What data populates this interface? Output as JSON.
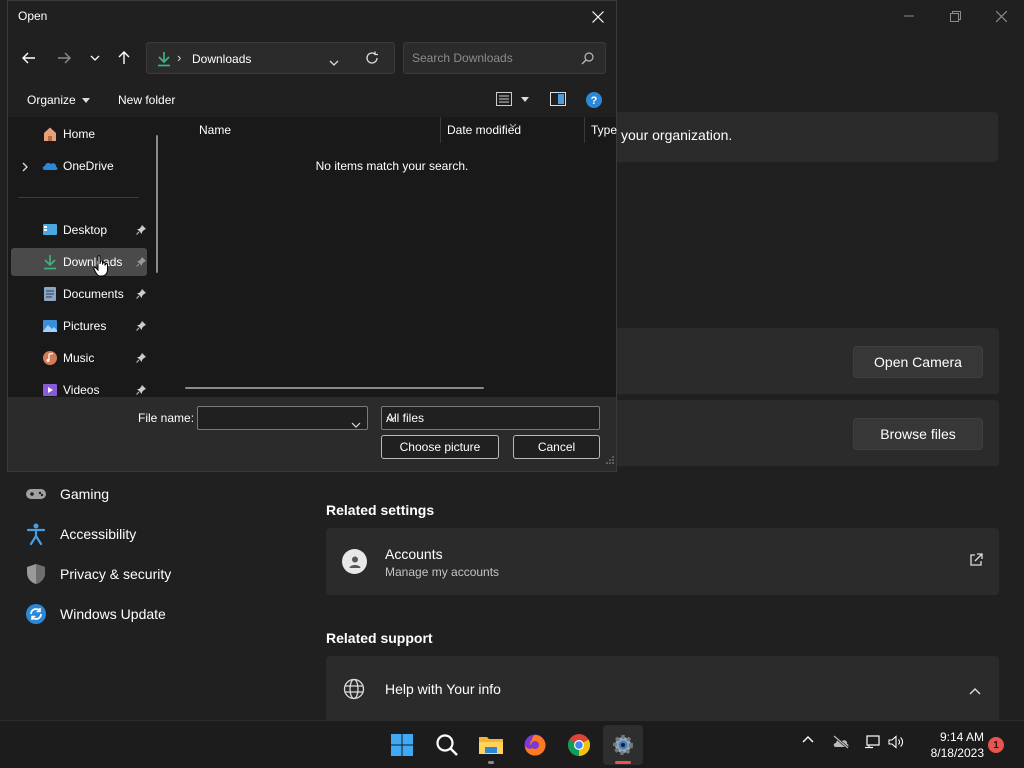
{
  "dialog": {
    "title": "Open",
    "address": {
      "location": "Downloads"
    },
    "search": {
      "placeholder": "Search Downloads"
    },
    "commands": {
      "organize": "Organize",
      "new_folder": "New folder"
    },
    "nav_items": [
      {
        "label": "Home",
        "icon": "home-icon",
        "pinned": false
      },
      {
        "label": "OneDrive",
        "icon": "onedrive-icon",
        "pinned": false
      },
      {
        "label": "Desktop",
        "icon": "desktop-icon",
        "pinned": true
      },
      {
        "label": "Downloads",
        "icon": "download-icon",
        "pinned": true,
        "selected": true
      },
      {
        "label": "Documents",
        "icon": "documents-icon",
        "pinned": true
      },
      {
        "label": "Pictures",
        "icon": "pictures-icon",
        "pinned": true
      },
      {
        "label": "Music",
        "icon": "music-icon",
        "pinned": true
      },
      {
        "label": "Videos",
        "icon": "videos-icon",
        "pinned": true
      }
    ],
    "columns": [
      "Name",
      "Date modified",
      "Type"
    ],
    "empty_message": "No items match your search.",
    "file_name_label": "File name:",
    "file_name_value": "",
    "file_type": "All files",
    "choose_button": "Choose picture",
    "cancel_button": "Cancel"
  },
  "settings": {
    "banner_text": "your organization.",
    "open_camera": "Open Camera",
    "browse_files": "Browse files",
    "nav": [
      {
        "label": "Gaming",
        "icon": "gaming-icon"
      },
      {
        "label": "Accessibility",
        "icon": "accessibility-icon"
      },
      {
        "label": "Privacy & security",
        "icon": "shield-icon"
      },
      {
        "label": "Windows Update",
        "icon": "update-icon"
      }
    ],
    "related_settings_title": "Related settings",
    "accounts_title": "Accounts",
    "accounts_sub": "Manage my accounts",
    "related_support_title": "Related support",
    "help_title": "Help with Your info"
  },
  "taskbar": {
    "time": "9:14 AM",
    "date": "8/18/2023",
    "notification_count": "1"
  },
  "colors": {
    "background": "#202020",
    "card": "#2b2b2b",
    "accent_green": "#3fb27f",
    "accent_blue": "#4a9ee0"
  }
}
